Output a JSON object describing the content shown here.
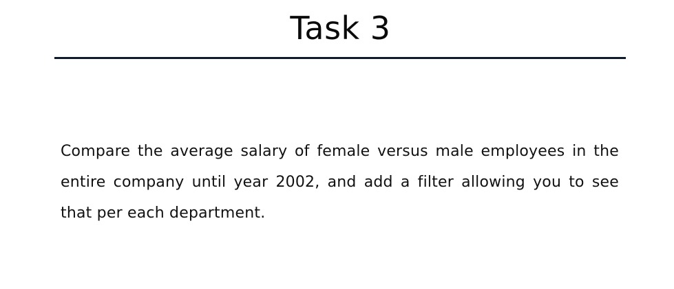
{
  "slide": {
    "title": "Task 3",
    "body": "Compare the average salary of female versus male employees in the entire company until year 2002, and add a filter allowing you to see that per each department."
  },
  "colors": {
    "rule": "#0f1b2d",
    "text": "#111111",
    "background": "#ffffff"
  }
}
